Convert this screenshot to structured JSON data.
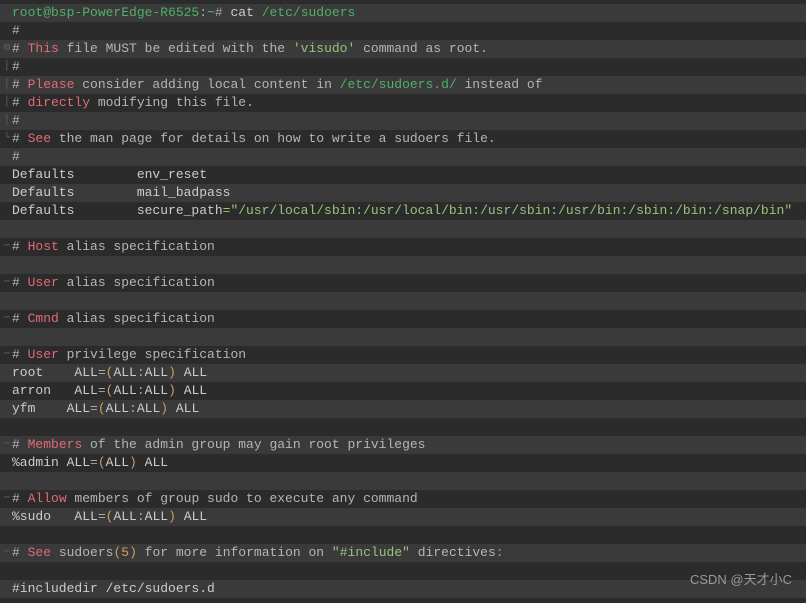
{
  "prompt": {
    "user_host": "root@bsp-PowerEdge-R6525",
    "sep1": ":",
    "path": "~",
    "sep2": "# ",
    "cmd": "cat ",
    "arg": "/etc/sudoers"
  },
  "lines": {
    "l2": "#",
    "l3a": "# ",
    "l3b": "This",
    "l3c": " file MUST be edited with the ",
    "l3d": "'visudo'",
    "l3e": " command as root.",
    "l4": "#",
    "l5a": "# ",
    "l5b": "Please",
    "l5c": " consider adding local content in ",
    "l5d": "/etc/sudoers.d/",
    "l5e": " instead of",
    "l6a": "# ",
    "l6b": "directly",
    "l6c": " modifying this file.",
    "l7": "#",
    "l8a": "# ",
    "l8b": "See",
    "l8c": " the man page for details on how to write a sudoers file.",
    "l9": "#",
    "l10": "Defaults        env_reset",
    "l11": "Defaults        mail_badpass",
    "l12a": "Defaults        secure_path",
    "l12b": "=\"/usr/local/sbin:/usr/local/bin:/usr/sbin:/usr/bin:/sbin:/bin:/snap/bin\"",
    "l14a": "# ",
    "l14b": "Host",
    "l14c": " alias specification",
    "l16a": "# ",
    "l16b": "User",
    "l16c": " alias specification",
    "l18a": "# ",
    "l18b": "Cmnd",
    "l18c": " alias specification",
    "l20a": "# ",
    "l20b": "User",
    "l20c": " privilege specification",
    "user1a": "root    ALL",
    "user1b": "=",
    "user1c": "(",
    "user1d": "ALL",
    "user1e": ":",
    "user1f": "ALL",
    "user1g": ")",
    "user1h": " ALL",
    "user2a": "arron   ALL",
    "user2b": "=",
    "user2c": "(",
    "user2d": "ALL",
    "user2e": ":",
    "user2f": "ALL",
    "user2g": ")",
    "user2h": " ALL",
    "user3a": "yfm    ALL",
    "user3b": "=",
    "user3c": "(",
    "user3d": "ALL",
    "user3e": ":",
    "user3f": "ALL",
    "user3g": ")",
    "user3h": " ALL",
    "l25a": "# ",
    "l25b": "Members",
    "l25c": " of the admin group may gain root privileges",
    "admin_a": "%admin ALL",
    "admin_b": "=",
    "admin_c": "(",
    "admin_d": "ALL",
    "admin_e": ")",
    "admin_f": " ALL",
    "l28a": "# ",
    "l28b": "Allow",
    "l28c": " members of group sudo to execute any command",
    "sudo_a": "%sudo   ALL",
    "sudo_b": "=",
    "sudo_c": "(",
    "sudo_d": "ALL",
    "sudo_e": ":",
    "sudo_f": "ALL",
    "sudo_g": ")",
    "sudo_h": " ALL",
    "l31a": "# ",
    "l31b": "See",
    "l31c": " sudoers",
    "l31d": "(",
    "l31e": "5",
    "l31f": ")",
    "l31g": " for more information on ",
    "l31h": "\"#include\"",
    "l31i": " directives",
    "l31j": ":",
    "l33": "#includedir /etc/sudoers.d"
  },
  "watermark": "CSDN @天才小C"
}
